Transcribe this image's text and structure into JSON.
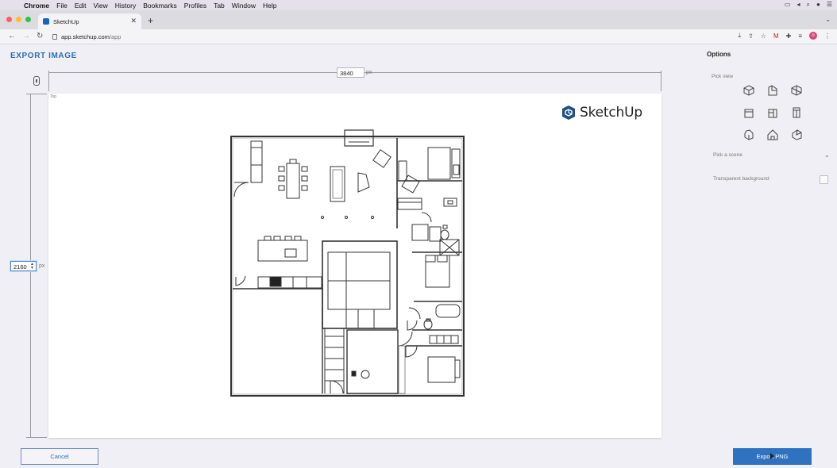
{
  "menubar": {
    "apple_icon": "apple-icon",
    "items": [
      "Chrome",
      "File",
      "Edit",
      "View",
      "History",
      "Bookmarks",
      "Profiles",
      "Tab",
      "Window",
      "Help"
    ]
  },
  "browser": {
    "tab_title": "SketchUp",
    "url_domain": "app.sketchup.com",
    "url_path": "/app",
    "profile_initial": "o",
    "colors": {
      "close": "#ff5f57",
      "minimize": "#febc2e",
      "maximize": "#28c840"
    }
  },
  "dialog": {
    "title": "EXPORT IMAGE",
    "width_value": "3840",
    "width_unit": "px",
    "height_value": "2160",
    "height_unit": "px",
    "view_label": "Top",
    "logo_text": "SketchUp",
    "accent_color": "#2e6fb0"
  },
  "options": {
    "title": "Options",
    "pick_view_label": "Pick view",
    "views": [
      "iso-view",
      "top-view",
      "front-view",
      "right-view",
      "back-view",
      "left-view",
      "bottom-view",
      "home-view",
      "perspective-view"
    ],
    "pick_scene_label": "Pick a scene",
    "transparent_label": "Transparent background",
    "transparent_checked": false
  },
  "buttons": {
    "cancel_label": "Cancel",
    "export_label": "Export PNG"
  }
}
